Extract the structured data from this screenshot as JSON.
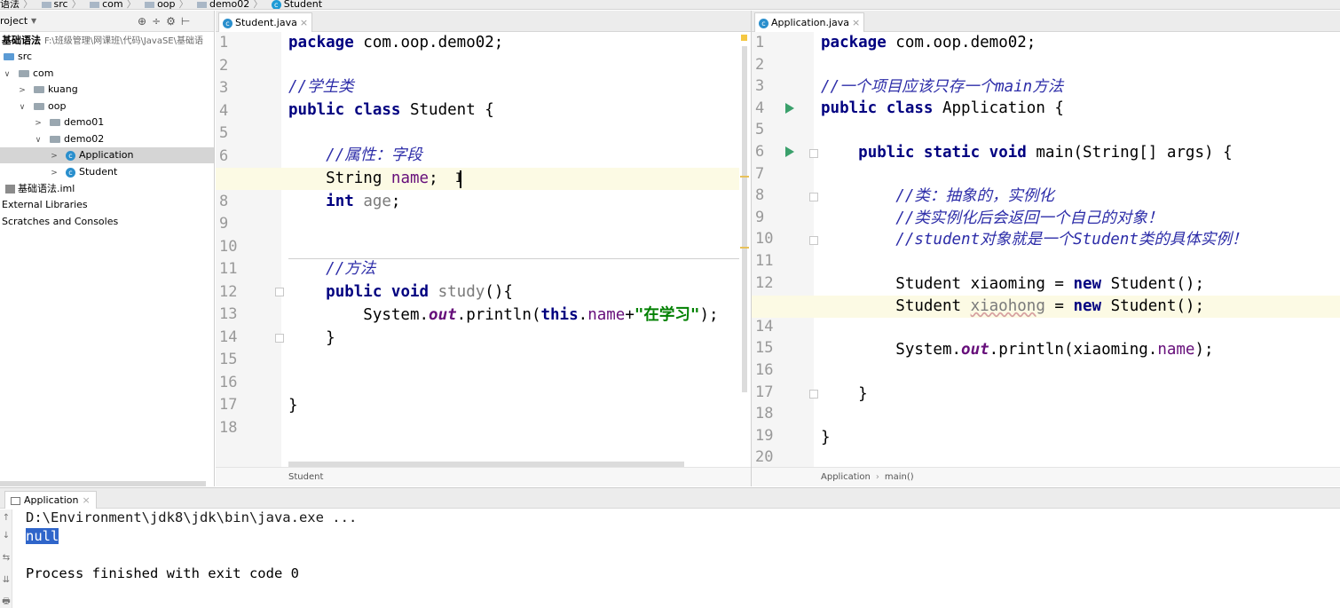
{
  "breadcrumb": {
    "items": [
      "语法",
      "src",
      "com",
      "oop",
      "demo02",
      "Student"
    ]
  },
  "project_panel": {
    "title": "roject",
    "dropdown_icon": "chevron-down-icon",
    "toolbar_icons": [
      "⊕",
      "÷",
      "⚙",
      "⊢"
    ],
    "tree": [
      {
        "label": "基础语法",
        "path": "F:\\班级管理\\网课班\\代码\\JavaSE\\基础语",
        "indent": 0,
        "icon": "module-icon",
        "arrow": ""
      },
      {
        "label": "src",
        "indent": 0,
        "icon": "folder-icon",
        "arrow": ""
      },
      {
        "label": "com",
        "indent": 1,
        "icon": "folder-icon",
        "arrow": "∨"
      },
      {
        "label": "kuang",
        "indent": 2,
        "icon": "folder-icon",
        "arrow": ">"
      },
      {
        "label": "oop",
        "indent": 2,
        "icon": "folder-icon",
        "arrow": "∨"
      },
      {
        "label": "demo01",
        "indent": 3,
        "icon": "folder-icon",
        "arrow": ">"
      },
      {
        "label": "demo02",
        "indent": 3,
        "icon": "folder-icon",
        "arrow": "∨"
      },
      {
        "label": "Application",
        "indent": 4,
        "icon": "class-icon",
        "arrow": ">",
        "selected": true
      },
      {
        "label": "Student",
        "indent": 4,
        "icon": "class-icon",
        "arrow": ">"
      },
      {
        "label": "基础语法.iml",
        "indent": 0,
        "icon": "iml-icon",
        "arrow": ""
      },
      {
        "label": "External Libraries",
        "indent": 0,
        "icon": "",
        "arrow": ""
      },
      {
        "label": "Scratches and Consoles",
        "indent": 0,
        "icon": "",
        "arrow": ""
      }
    ]
  },
  "editor_left": {
    "tab": {
      "label": "Student.java",
      "close": "×",
      "icon": "class-icon"
    },
    "line_numbers": [
      "1",
      "2",
      "3",
      "4",
      "5",
      "6",
      "7",
      "8",
      "9",
      "10",
      "11",
      "12",
      "13",
      "14",
      "15",
      "16",
      "17",
      "18"
    ],
    "status": "Student"
  },
  "editor_right": {
    "tab": {
      "label": "Application.java",
      "close": "×",
      "icon": "class-icon"
    },
    "line_numbers": [
      "1",
      "2",
      "3",
      "4",
      "5",
      "6",
      "7",
      "8",
      "9",
      "10",
      "11",
      "12",
      "13",
      "14",
      "15",
      "16",
      "17",
      "18",
      "19",
      "20"
    ],
    "status_class": "Application",
    "status_sep": "›",
    "status_method": "main()"
  },
  "run_panel": {
    "tab": {
      "label": "Application",
      "close": "×"
    },
    "tools": [
      "↑",
      "↓",
      "⇆",
      "⇊",
      "🖶"
    ],
    "console": {
      "command": "D:\\Environment\\jdk8\\jdk\\bin\\java.exe ...",
      "output": "null",
      "finished": "Process finished with exit code 0"
    }
  },
  "colors": {
    "keyword": "#000080",
    "comment": "#2c2ca8",
    "field": "#660e7a",
    "string": "#008000",
    "current_line": "#fcfae4",
    "selection": "#2f65ca"
  }
}
